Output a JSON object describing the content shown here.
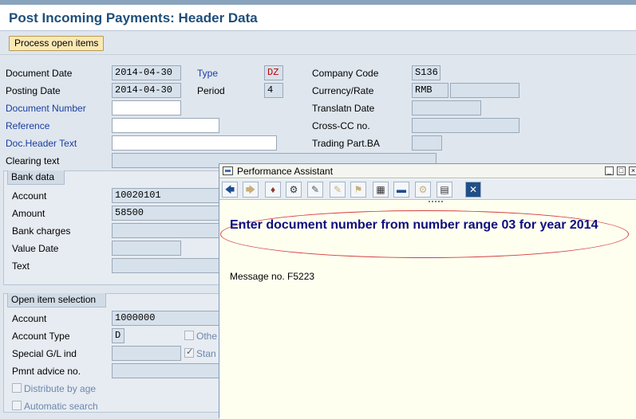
{
  "header": {
    "title": "Post Incoming Payments: Header Data"
  },
  "toolbar": {
    "process_open_items": "Process open items"
  },
  "form": {
    "document_date": {
      "label": "Document Date",
      "value": "2014-04-30"
    },
    "type": {
      "label": "Type",
      "value": "DZ"
    },
    "company_code": {
      "label": "Company Code",
      "value": "S136"
    },
    "posting_date": {
      "label": "Posting Date",
      "value": "2014-04-30"
    },
    "period": {
      "label": "Period",
      "value": "4"
    },
    "currency_rate": {
      "label": "Currency/Rate",
      "value": "RMB",
      "rate": ""
    },
    "document_number": {
      "label": "Document Number",
      "value": ""
    },
    "translatn_date": {
      "label": "Translatn Date",
      "value": ""
    },
    "reference": {
      "label": "Reference",
      "value": ""
    },
    "cross_cc": {
      "label": "Cross-CC no.",
      "value": ""
    },
    "doc_header_text": {
      "label": "Doc.Header Text",
      "value": ""
    },
    "trading_part_ba": {
      "label": "Trading Part.BA",
      "value": ""
    },
    "clearing_text": {
      "label": "Clearing text",
      "value": ""
    }
  },
  "bank_data": {
    "tab": "Bank data",
    "account": {
      "label": "Account",
      "value": "10020101"
    },
    "amount": {
      "label": "Amount",
      "value": "58500"
    },
    "bank_charges": {
      "label": "Bank charges",
      "value": ""
    },
    "value_date": {
      "label": "Value Date",
      "value": ""
    },
    "text": {
      "label": "Text",
      "value": ""
    }
  },
  "open_item_selection": {
    "tab": "Open item selection",
    "account": {
      "label": "Account",
      "value": "1000000"
    },
    "account_type": {
      "label": "Account Type",
      "value": "D"
    },
    "others_label": "Othe",
    "special_gl": {
      "label": "Special G/L ind",
      "value": ""
    },
    "standard_label": "Stan",
    "pmnt_advice": {
      "label": "Pmnt advice no.",
      "value": ""
    },
    "distribute_by_age": "Distribute by age",
    "automatic_search": "Automatic search"
  },
  "assistant": {
    "title": "Performance Assistant",
    "heading": "Enter document number from number range 03 for year 2014",
    "message": "Message no. F5223",
    "highlight_color": "#d2403f"
  },
  "icons": {
    "toolbar": [
      "back-arrow-icon",
      "forward-arrow-icon",
      "book-icon",
      "technical-info-icon",
      "edit-icon",
      "note-icon",
      "bookmark-icon",
      "table-icon",
      "tag-icon",
      "settings-icon",
      "print-icon",
      "close-icon"
    ]
  }
}
